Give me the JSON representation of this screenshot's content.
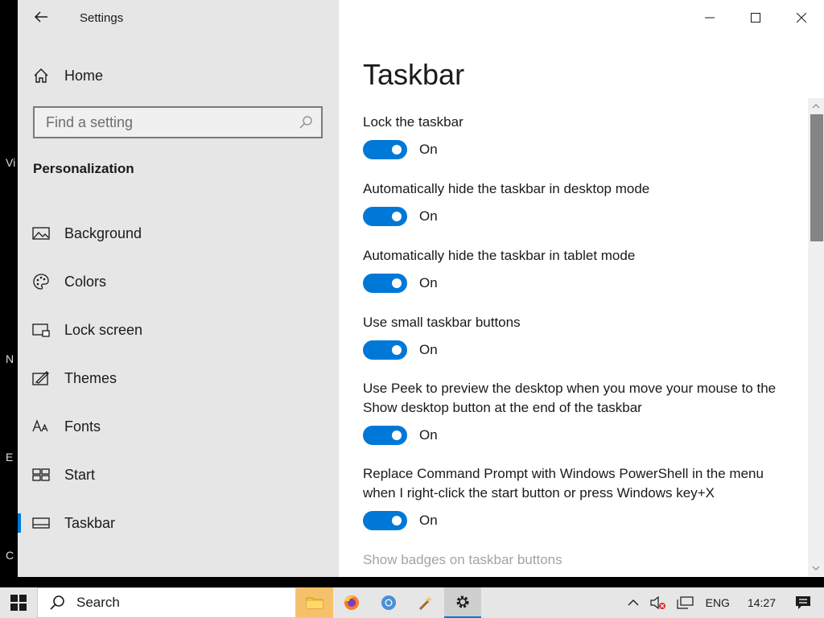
{
  "window": {
    "title": "Settings"
  },
  "sidebar": {
    "home_label": "Home",
    "search_placeholder": "Find a setting",
    "section_title": "Personalization",
    "items": [
      {
        "label": "Background",
        "icon": "image-icon"
      },
      {
        "label": "Colors",
        "icon": "palette-icon"
      },
      {
        "label": "Lock screen",
        "icon": "lock-screen-icon"
      },
      {
        "label": "Themes",
        "icon": "themes-icon"
      },
      {
        "label": "Fonts",
        "icon": "fonts-icon"
      },
      {
        "label": "Start",
        "icon": "start-icon"
      },
      {
        "label": "Taskbar",
        "icon": "taskbar-icon",
        "selected": true
      }
    ]
  },
  "main": {
    "title": "Taskbar",
    "settings": [
      {
        "label": "Lock the taskbar",
        "state": "On"
      },
      {
        "label": "Automatically hide the taskbar in desktop mode",
        "state": "On"
      },
      {
        "label": "Automatically hide the taskbar in tablet mode",
        "state": "On"
      },
      {
        "label": "Use small taskbar buttons",
        "state": "On"
      },
      {
        "label": "Use Peek to preview the desktop when you move your mouse to the Show desktop button at the end of the taskbar",
        "state": "On"
      },
      {
        "label": "Replace Command Prompt with Windows PowerShell in the menu when I right-click the start button or press Windows key+X",
        "state": "On"
      }
    ],
    "partial_setting_label": "Show badges on taskbar buttons"
  },
  "desktop": {
    "letters": [
      "Vi",
      "N",
      "E",
      "C"
    ]
  },
  "taskbar": {
    "search_label": "Search",
    "language": "ENG",
    "time": "14:27"
  },
  "colors": {
    "accent": "#0078d7",
    "sidebar_bg": "#e6e6e6"
  }
}
